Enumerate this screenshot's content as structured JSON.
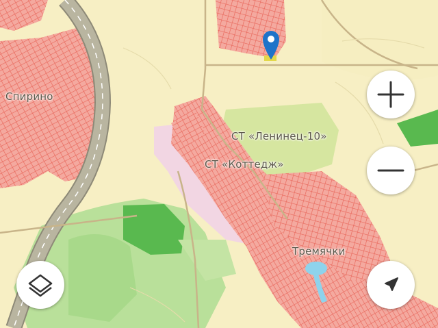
{
  "map": {
    "labels": {
      "spirino": "Спирино",
      "leninets": "СТ «Ленинец-10»",
      "kottedzh": "СТ «Коттедж»",
      "tremyachki": "Тремячки"
    },
    "colors": {
      "background": "#f7efc4",
      "settlement": "#f2a79e",
      "settlement_lines": "#e9695c",
      "forest": "#a9d98a",
      "dark_forest": "#4fb84a",
      "garden_area": "#d9e7a3",
      "industrial": "#f2d7e3",
      "highway": "#b6b19c",
      "road": "#c9b793",
      "water": "#8fd3ec"
    },
    "icons": {
      "zoom_in": "plus-icon",
      "zoom_out": "minus-icon",
      "layers": "layers-icon",
      "locate": "navigation-arrow-icon",
      "marker": "location-pin-icon"
    }
  }
}
